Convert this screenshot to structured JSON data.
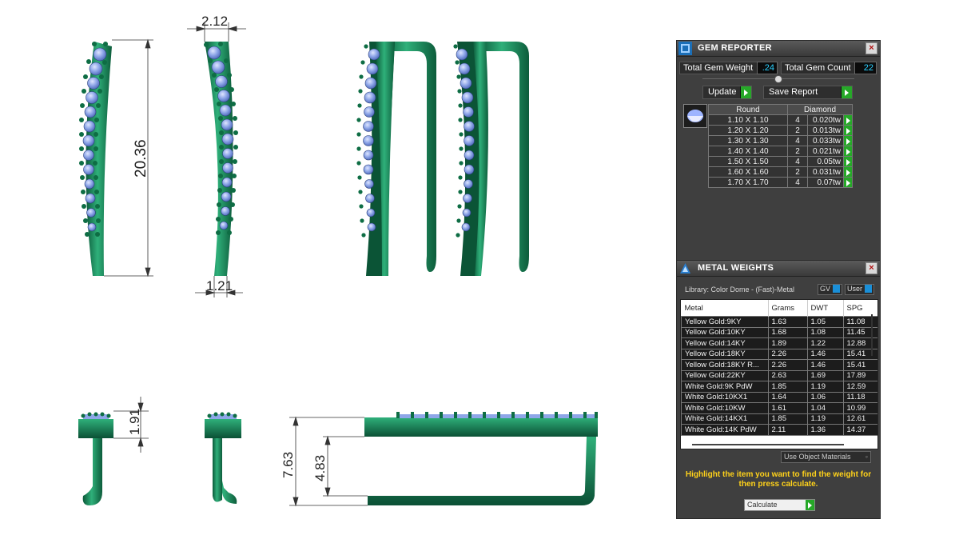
{
  "dimensions": {
    "top_width": "2.12",
    "height": "20.36",
    "bottom_width": "1.21",
    "head_height": "1.91",
    "side_height": "7.63",
    "side_inner": "4.83"
  },
  "gem_reporter": {
    "title": "GEM REPORTER",
    "total_weight_label": "Total Gem Weight",
    "total_weight": ".24",
    "total_count_label": "Total Gem Count",
    "total_count": "22",
    "update_label": "Update",
    "save_label": "Save Report",
    "shape": "Round",
    "stone": "Diamond",
    "rows": [
      {
        "size": "1.10 X 1.10",
        "count": "4",
        "tw": "0.020tw"
      },
      {
        "size": "1.20 X 1.20",
        "count": "2",
        "tw": "0.013tw"
      },
      {
        "size": "1.30 X 1.30",
        "count": "4",
        "tw": "0.033tw"
      },
      {
        "size": "1.40 X 1.40",
        "count": "2",
        "tw": "0.021tw"
      },
      {
        "size": "1.50 X 1.50",
        "count": "4",
        "tw": "0.05tw"
      },
      {
        "size": "1.60 X 1.60",
        "count": "2",
        "tw": "0.031tw"
      },
      {
        "size": "1.70 X 1.70",
        "count": "4",
        "tw": "0.07tw"
      }
    ]
  },
  "metal_weights": {
    "title": "METAL WEIGHTS",
    "library": "Library: Color Dome - (Fast)-Metal",
    "gv_label": "GV",
    "user_label": "User",
    "columns": [
      "Metal",
      "Grams",
      "DWT",
      "SPG"
    ],
    "rows": [
      [
        "Yellow Gold:9KY",
        "1.63",
        "1.05",
        "11.08"
      ],
      [
        "Yellow Gold:10KY",
        "1.68",
        "1.08",
        "11.45"
      ],
      [
        "Yellow Gold:14KY",
        "1.89",
        "1.22",
        "12.88"
      ],
      [
        "Yellow Gold:18KY",
        "2.26",
        "1.46",
        "15.41"
      ],
      [
        "Yellow Gold:18KY R...",
        "2.26",
        "1.46",
        "15.41"
      ],
      [
        "Yellow Gold:22KY",
        "2.63",
        "1.69",
        "17.89"
      ],
      [
        "White Gold:9K PdW",
        "1.85",
        "1.19",
        "12.59"
      ],
      [
        "White Gold:10KX1",
        "1.64",
        "1.06",
        "11.18"
      ],
      [
        "White Gold:10KW",
        "1.61",
        "1.04",
        "10.99"
      ],
      [
        "White Gold:14KX1",
        "1.85",
        "1.19",
        "12.61"
      ],
      [
        "White Gold:14K PdW",
        "2.11",
        "1.36",
        "14.37"
      ]
    ],
    "use_materials": "Use Object Materials",
    "hint": "Highlight the item you want to find the weight for then press calculate.",
    "calculate": "Calculate"
  }
}
